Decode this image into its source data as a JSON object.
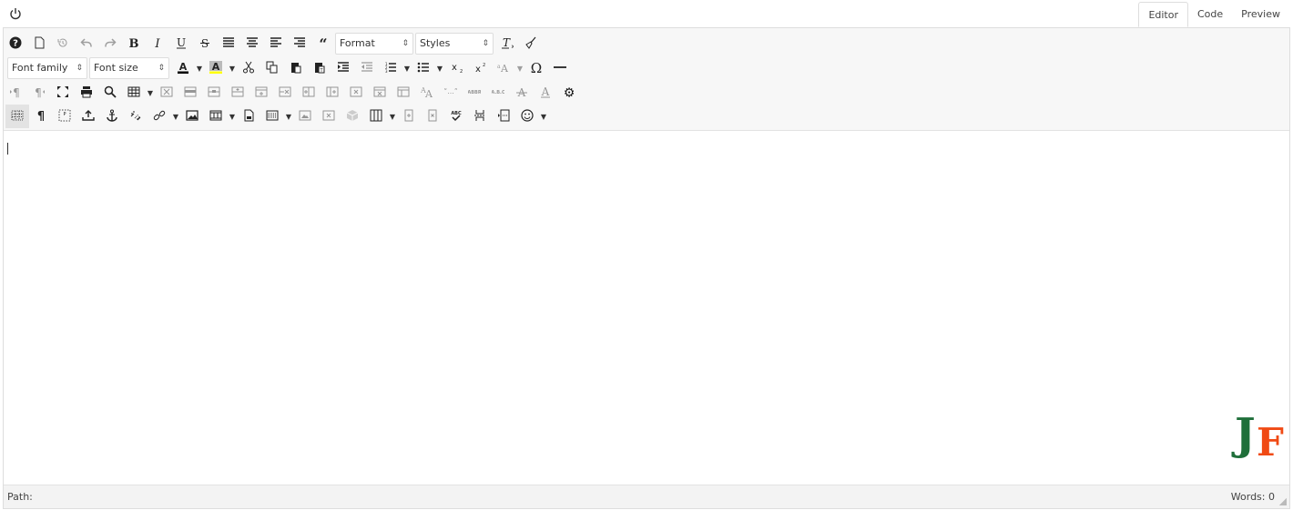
{
  "header": {
    "power_icon": "power-icon",
    "tabs": [
      {
        "label": "Editor",
        "active": true
      },
      {
        "label": "Code",
        "active": false
      },
      {
        "label": "Preview",
        "active": false
      }
    ]
  },
  "toolbar": {
    "format_select": "Format",
    "styles_select": "Styles",
    "font_family_select": "Font family",
    "font_size_select": "Font size",
    "text_color": "#000000",
    "highlight_color": "#ffff00"
  },
  "statusbar": {
    "path_label": "Path:",
    "word_count": "Words: 0"
  },
  "logo": {
    "letter1": "J",
    "letter2": "F",
    "color1": "#1f6f3a",
    "color2": "#f04a14"
  }
}
